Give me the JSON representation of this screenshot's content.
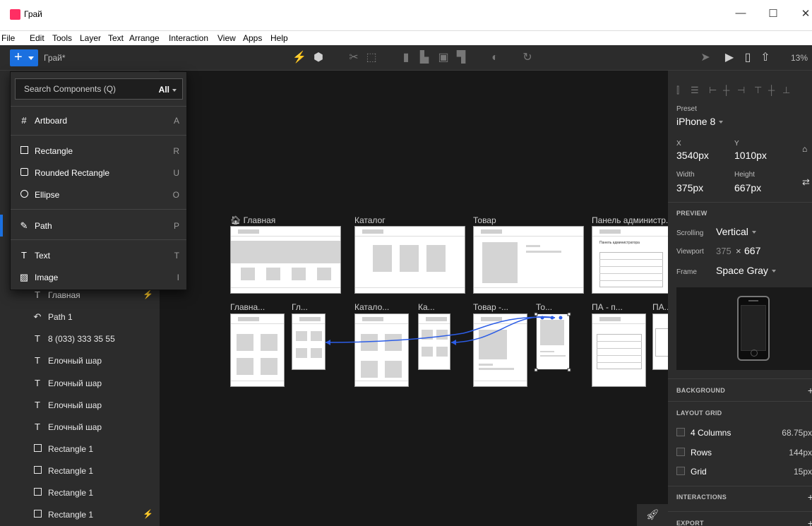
{
  "window": {
    "title": "Грай",
    "doc_name": "Грай*",
    "controls": {
      "minimize": "—",
      "maximize": "☐",
      "close": "✕"
    }
  },
  "menu": [
    "File",
    "Edit",
    "Tools",
    "Layer",
    "Text",
    "Arrange",
    "Interaction",
    "View",
    "Apps",
    "Help"
  ],
  "toolbar": {
    "add_label": "+",
    "zoom": "13%",
    "icons": [
      "bolt-icon",
      "component-icon",
      "mask-icon",
      "frame-icon",
      "boolean-union-icon",
      "boolean-subtract-icon",
      "boolean-intersect-icon",
      "boolean-difference-icon",
      "flatten-icon",
      "rotate-icon",
      "cursor-icon",
      "play-icon",
      "device-icon",
      "share-icon"
    ]
  },
  "components": {
    "search_placeholder": "Search Components (Q)",
    "filter": "All",
    "items": [
      {
        "label": "Artboard",
        "key": "A",
        "icon": "artboard-icon"
      },
      {
        "label": "Rectangle",
        "key": "R",
        "icon": "rectangle-icon"
      },
      {
        "label": "Rounded Rectangle",
        "key": "U",
        "icon": "rounded-rectangle-icon"
      },
      {
        "label": "Ellipse",
        "key": "O",
        "icon": "ellipse-icon"
      },
      {
        "label": "Path",
        "key": "P",
        "icon": "path-icon"
      },
      {
        "label": "Text",
        "key": "T",
        "icon": "text-icon"
      },
      {
        "label": "Image",
        "key": "I",
        "icon": "image-icon"
      }
    ]
  },
  "layers": [
    {
      "label": "Главная",
      "icon": "text-icon",
      "bolt": true
    },
    {
      "label": "Path 1",
      "icon": "path-icon",
      "bolt": false
    },
    {
      "label": "8 (033) 333 35 55",
      "icon": "text-icon",
      "bolt": false
    },
    {
      "label": "Елочный шар",
      "icon": "text-icon",
      "bolt": false
    },
    {
      "label": "Елочный шар",
      "icon": "text-icon",
      "bolt": false
    },
    {
      "label": "Елочный шар",
      "icon": "text-icon",
      "bolt": false
    },
    {
      "label": "Елочный шар",
      "icon": "text-icon",
      "bolt": false
    },
    {
      "label": "Rectangle 1",
      "icon": "rectangle-icon",
      "bolt": false
    },
    {
      "label": "Rectangle 1",
      "icon": "rectangle-icon",
      "bolt": false
    },
    {
      "label": "Rectangle 1",
      "icon": "rectangle-icon",
      "bolt": false
    },
    {
      "label": "Rectangle 1",
      "icon": "rectangle-icon",
      "bolt": true
    }
  ],
  "canvas": {
    "top_row": [
      "Главная",
      "Каталог",
      "Товар",
      "Панель администр..."
    ],
    "bottom_row": [
      "Главна...",
      "Гл...",
      "Катало...",
      "Ка...",
      "Товар -...",
      "То...",
      "ПА - п...",
      "ПА..."
    ],
    "artboard_admin_title": "Панель администратора"
  },
  "inspector": {
    "preset_label": "Preset",
    "preset_value": "iPhone 8",
    "x_label": "X",
    "x_value": "3540px",
    "y_label": "Y",
    "y_value": "1010px",
    "width_label": "Width",
    "width_value": "375px",
    "height_label": "Height",
    "height_value": "667px",
    "preview_header": "PREVIEW",
    "scrolling_label": "Scrolling",
    "scrolling_value": "Vertical",
    "viewport_label": "Viewport",
    "viewport_w": "375",
    "viewport_x": "×",
    "viewport_h": "667",
    "frame_label": "Frame",
    "frame_value": "Space Gray",
    "background_header": "BACKGROUND",
    "layout_grid_header": "LAYOUT GRID",
    "columns_label": "4 Columns",
    "columns_value": "68.75px",
    "rows_label": "Rows",
    "rows_value": "144px",
    "grid_label": "Grid",
    "grid_value": "15px",
    "interactions_header": "INTERACTIONS",
    "export_header": "EXPORT",
    "plus": "+"
  }
}
